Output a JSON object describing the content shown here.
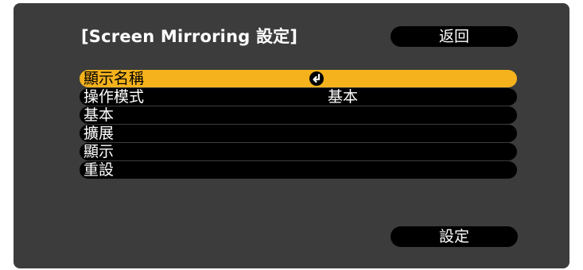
{
  "dialog": {
    "title": "[Screen Mirroring 設定]",
    "back_label": "返回",
    "set_label": "設定"
  },
  "menu": {
    "items": [
      {
        "label": "顯示名稱",
        "selected": true,
        "icon": "enter-icon"
      },
      {
        "label": "操作模式",
        "value": "基本"
      },
      {
        "label": "基本"
      },
      {
        "label": "擴展"
      },
      {
        "label": "顯示"
      },
      {
        "label": "重設"
      }
    ]
  },
  "colors": {
    "panel": "#3c3c3c",
    "row": "#000000",
    "highlight": "#f5b21c",
    "text": "#ffffff"
  }
}
